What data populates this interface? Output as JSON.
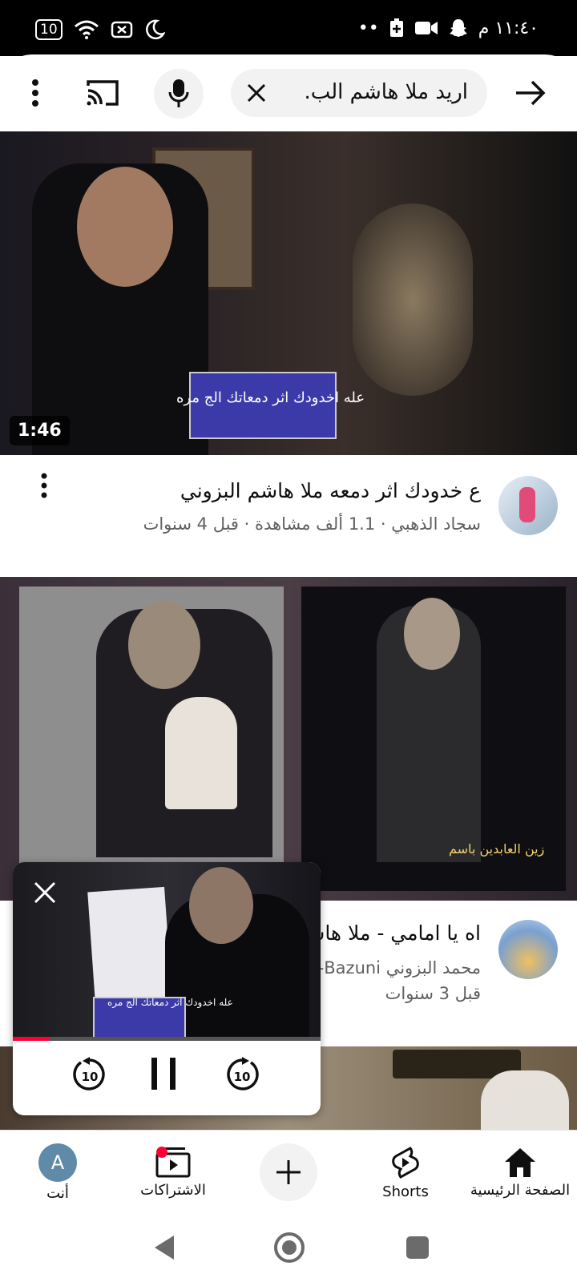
{
  "status": {
    "time": "١١:٤٠ م",
    "battery": "10",
    "dots": "••"
  },
  "search": {
    "query": "اريد ملا هاشم الب."
  },
  "videos": [
    {
      "duration": "1:46",
      "thumbnail_caption": "عله اخدودك اثر دمعاتك الج مره",
      "title": "ع خدودك اثر دمعه         ملا هاشم البزوني",
      "meta": "سجاد الذهبي · 1.1 ألف مشاهدة · قبل 4 سنوات"
    },
    {
      "thumbnail_caption": "زين العابدين باسم",
      "title": "اه يا امامي - ملا هاشم",
      "channel": "محمد البزوني Bazuni-",
      "meta": "قبل 3 سنوات"
    }
  ],
  "mini_player": {
    "caption": "عله اخدودك اثر دمعاتك الج مره",
    "progress": 0.12,
    "seek_back": "10",
    "seek_forward": "10"
  },
  "bottom_nav": {
    "you": "أنت",
    "you_avatar": "A",
    "subscriptions": "الاشتراكات",
    "shorts": "Shorts",
    "home": "الصفحة الرئيسية"
  },
  "colors": {
    "accent": "#ff0033",
    "you_avatar_bg": "#5f8aa8"
  }
}
